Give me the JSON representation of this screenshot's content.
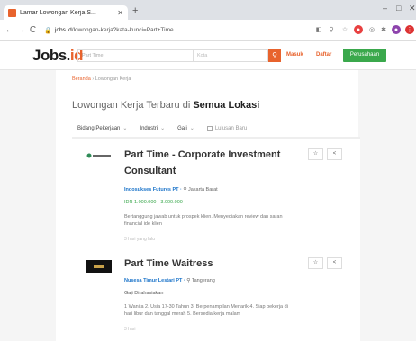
{
  "browser": {
    "tab_title": "Lamar Lowongan Kerja S...",
    "url_domain": "jobs.id",
    "url_path": "/lowongan-kerja?kata-kunci=Part+Time"
  },
  "header": {
    "logo_main": "Jobs.",
    "logo_accent": "id",
    "search_placeholder": "Part Time",
    "location_placeholder": "Kota",
    "login": "Masuk",
    "register": "Daftar",
    "company": "Perusahaan"
  },
  "breadcrumb": {
    "home": "Beranda",
    "sep": "›",
    "current": "Lowongan Kerja"
  },
  "heading": {
    "prefix": "Lowongan Kerja Terbaru di ",
    "location": "Semua Lokasi"
  },
  "filters": {
    "field": "Bidang Pekerjaan",
    "industry": "Industri",
    "salary": "Gaji",
    "newest": "Lulusan Baru"
  },
  "jobs": [
    {
      "title": "Part Time - Corporate Investment Consultant",
      "company": "Indosukses Futures PT",
      "location": "Jakarta Barat",
      "salary": "IDR 1.000.000 - 3.000.000",
      "desc": "Bertanggung jawab untuk prospek klien. Menyediakan review dan saran financial ide klien",
      "ago": "3 hari yang lalu"
    },
    {
      "title": "Part Time Waitress",
      "company": "Nusesa Timur Lestari PT",
      "location": "Tangerang",
      "salary": "Gaji Dirahasiakan",
      "desc": "1 Wanita 2. Usia 17-30 Tahun 3. Berpenampilan Menarik 4. Siap bekerja di hari libur dan tanggal merah 5. Bersedia kerja malam",
      "ago": "3 hari"
    }
  ]
}
